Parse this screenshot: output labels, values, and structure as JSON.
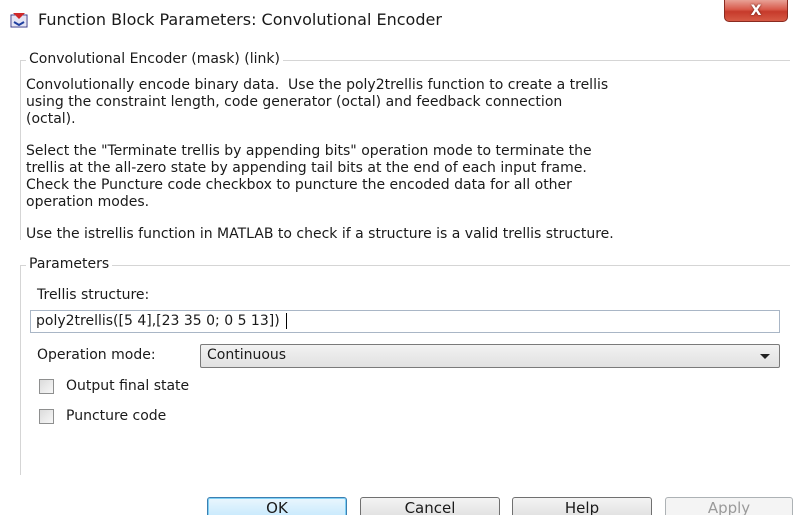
{
  "window": {
    "title": "Function Block Parameters: Convolutional Encoder",
    "close_glyph": "X"
  },
  "mask": {
    "header": "Convolutional Encoder (mask) (link)",
    "description": [
      "Convolutionally encode binary data.  Use the poly2trellis function to create a trellis\nusing the constraint length, code generator (octal) and feedback connection\n(octal).",
      "Select the \"Terminate trellis by appending bits\" operation mode to terminate the\ntrellis at the all-zero state by appending tail bits at the end of each input frame.\nCheck the Puncture code checkbox to puncture the encoded data for all other\noperation modes.",
      "Use the istrellis function in MATLAB to check if a structure is a valid trellis structure."
    ]
  },
  "parameters": {
    "header": "Parameters",
    "trellis_label": "Trellis structure:",
    "trellis_value": "poly2trellis([5 4],[23 35 0; 0 5 13])",
    "operation_mode_label": "Operation mode:",
    "operation_mode_value": "Continuous",
    "output_final_state": {
      "label": "Output final state",
      "checked": false
    },
    "puncture_code": {
      "label": "Puncture code",
      "checked": false
    }
  },
  "buttons": {
    "ok": "OK",
    "cancel": "Cancel",
    "help": "Help",
    "apply": "Apply"
  },
  "icons": {
    "app": "simulink-block-icon",
    "close": "close-icon",
    "dropdown": "chevron-down-icon"
  },
  "colors": {
    "close_button": "#c63a2b",
    "default_button_border": "#3c7fb1",
    "groupbox_border": "#d5d5d5"
  }
}
